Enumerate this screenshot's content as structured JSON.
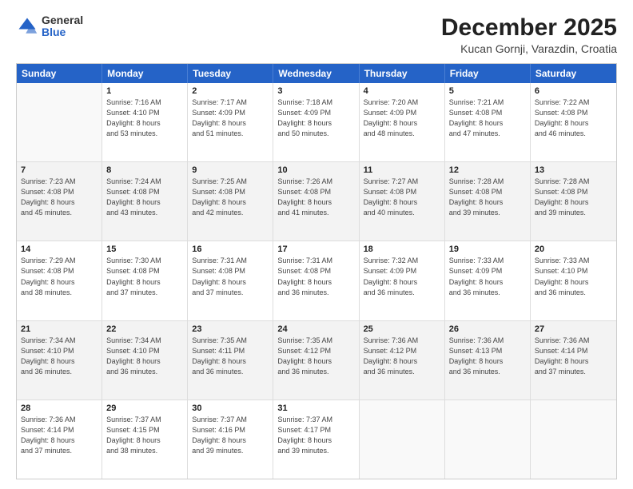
{
  "header": {
    "logo": {
      "general": "General",
      "blue": "Blue"
    },
    "title": "December 2025",
    "subtitle": "Kucan Gornji, Varazdin, Croatia"
  },
  "calendar": {
    "days": [
      "Sunday",
      "Monday",
      "Tuesday",
      "Wednesday",
      "Thursday",
      "Friday",
      "Saturday"
    ],
    "rows": [
      [
        {
          "day": "",
          "lines": []
        },
        {
          "day": "1",
          "lines": [
            "Sunrise: 7:16 AM",
            "Sunset: 4:10 PM",
            "Daylight: 8 hours",
            "and 53 minutes."
          ]
        },
        {
          "day": "2",
          "lines": [
            "Sunrise: 7:17 AM",
            "Sunset: 4:09 PM",
            "Daylight: 8 hours",
            "and 51 minutes."
          ]
        },
        {
          "day": "3",
          "lines": [
            "Sunrise: 7:18 AM",
            "Sunset: 4:09 PM",
            "Daylight: 8 hours",
            "and 50 minutes."
          ]
        },
        {
          "day": "4",
          "lines": [
            "Sunrise: 7:20 AM",
            "Sunset: 4:09 PM",
            "Daylight: 8 hours",
            "and 48 minutes."
          ]
        },
        {
          "day": "5",
          "lines": [
            "Sunrise: 7:21 AM",
            "Sunset: 4:08 PM",
            "Daylight: 8 hours",
            "and 47 minutes."
          ]
        },
        {
          "day": "6",
          "lines": [
            "Sunrise: 7:22 AM",
            "Sunset: 4:08 PM",
            "Daylight: 8 hours",
            "and 46 minutes."
          ]
        }
      ],
      [
        {
          "day": "7",
          "lines": [
            "Sunrise: 7:23 AM",
            "Sunset: 4:08 PM",
            "Daylight: 8 hours",
            "and 45 minutes."
          ]
        },
        {
          "day": "8",
          "lines": [
            "Sunrise: 7:24 AM",
            "Sunset: 4:08 PM",
            "Daylight: 8 hours",
            "and 43 minutes."
          ]
        },
        {
          "day": "9",
          "lines": [
            "Sunrise: 7:25 AM",
            "Sunset: 4:08 PM",
            "Daylight: 8 hours",
            "and 42 minutes."
          ]
        },
        {
          "day": "10",
          "lines": [
            "Sunrise: 7:26 AM",
            "Sunset: 4:08 PM",
            "Daylight: 8 hours",
            "and 41 minutes."
          ]
        },
        {
          "day": "11",
          "lines": [
            "Sunrise: 7:27 AM",
            "Sunset: 4:08 PM",
            "Daylight: 8 hours",
            "and 40 minutes."
          ]
        },
        {
          "day": "12",
          "lines": [
            "Sunrise: 7:28 AM",
            "Sunset: 4:08 PM",
            "Daylight: 8 hours",
            "and 39 minutes."
          ]
        },
        {
          "day": "13",
          "lines": [
            "Sunrise: 7:28 AM",
            "Sunset: 4:08 PM",
            "Daylight: 8 hours",
            "and 39 minutes."
          ]
        }
      ],
      [
        {
          "day": "14",
          "lines": [
            "Sunrise: 7:29 AM",
            "Sunset: 4:08 PM",
            "Daylight: 8 hours",
            "and 38 minutes."
          ]
        },
        {
          "day": "15",
          "lines": [
            "Sunrise: 7:30 AM",
            "Sunset: 4:08 PM",
            "Daylight: 8 hours",
            "and 37 minutes."
          ]
        },
        {
          "day": "16",
          "lines": [
            "Sunrise: 7:31 AM",
            "Sunset: 4:08 PM",
            "Daylight: 8 hours",
            "and 37 minutes."
          ]
        },
        {
          "day": "17",
          "lines": [
            "Sunrise: 7:31 AM",
            "Sunset: 4:08 PM",
            "Daylight: 8 hours",
            "and 36 minutes."
          ]
        },
        {
          "day": "18",
          "lines": [
            "Sunrise: 7:32 AM",
            "Sunset: 4:09 PM",
            "Daylight: 8 hours",
            "and 36 minutes."
          ]
        },
        {
          "day": "19",
          "lines": [
            "Sunrise: 7:33 AM",
            "Sunset: 4:09 PM",
            "Daylight: 8 hours",
            "and 36 minutes."
          ]
        },
        {
          "day": "20",
          "lines": [
            "Sunrise: 7:33 AM",
            "Sunset: 4:10 PM",
            "Daylight: 8 hours",
            "and 36 minutes."
          ]
        }
      ],
      [
        {
          "day": "21",
          "lines": [
            "Sunrise: 7:34 AM",
            "Sunset: 4:10 PM",
            "Daylight: 8 hours",
            "and 36 minutes."
          ]
        },
        {
          "day": "22",
          "lines": [
            "Sunrise: 7:34 AM",
            "Sunset: 4:10 PM",
            "Daylight: 8 hours",
            "and 36 minutes."
          ]
        },
        {
          "day": "23",
          "lines": [
            "Sunrise: 7:35 AM",
            "Sunset: 4:11 PM",
            "Daylight: 8 hours",
            "and 36 minutes."
          ]
        },
        {
          "day": "24",
          "lines": [
            "Sunrise: 7:35 AM",
            "Sunset: 4:12 PM",
            "Daylight: 8 hours",
            "and 36 minutes."
          ]
        },
        {
          "day": "25",
          "lines": [
            "Sunrise: 7:36 AM",
            "Sunset: 4:12 PM",
            "Daylight: 8 hours",
            "and 36 minutes."
          ]
        },
        {
          "day": "26",
          "lines": [
            "Sunrise: 7:36 AM",
            "Sunset: 4:13 PM",
            "Daylight: 8 hours",
            "and 36 minutes."
          ]
        },
        {
          "day": "27",
          "lines": [
            "Sunrise: 7:36 AM",
            "Sunset: 4:14 PM",
            "Daylight: 8 hours",
            "and 37 minutes."
          ]
        }
      ],
      [
        {
          "day": "28",
          "lines": [
            "Sunrise: 7:36 AM",
            "Sunset: 4:14 PM",
            "Daylight: 8 hours",
            "and 37 minutes."
          ]
        },
        {
          "day": "29",
          "lines": [
            "Sunrise: 7:37 AM",
            "Sunset: 4:15 PM",
            "Daylight: 8 hours",
            "and 38 minutes."
          ]
        },
        {
          "day": "30",
          "lines": [
            "Sunrise: 7:37 AM",
            "Sunset: 4:16 PM",
            "Daylight: 8 hours",
            "and 39 minutes."
          ]
        },
        {
          "day": "31",
          "lines": [
            "Sunrise: 7:37 AM",
            "Sunset: 4:17 PM",
            "Daylight: 8 hours",
            "and 39 minutes."
          ]
        },
        {
          "day": "",
          "lines": []
        },
        {
          "day": "",
          "lines": []
        },
        {
          "day": "",
          "lines": []
        }
      ]
    ]
  }
}
